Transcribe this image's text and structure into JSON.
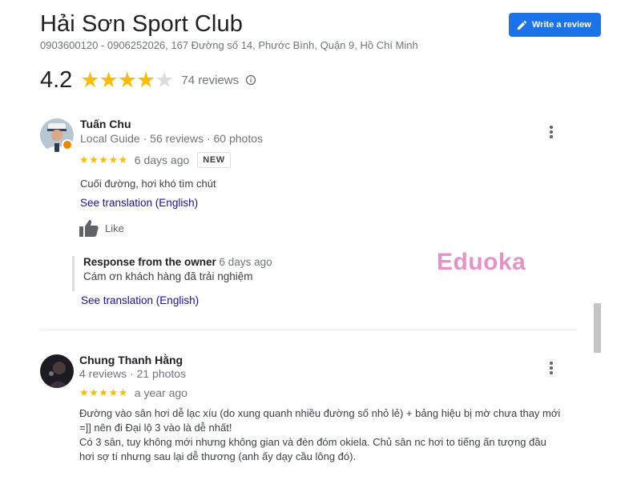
{
  "business": {
    "name": "Hải Sơn Sport Club",
    "contact": "0903600120 - 0906252026, 167 Đường số 14, Phước Bình, Quận 9, Hồ Chí Minh"
  },
  "write_review": {
    "label": "Write a review",
    "icon": "pencil-icon"
  },
  "summary": {
    "rating": "4.2",
    "stars_filled": 4,
    "stars_total": 5,
    "review_count": "74 reviews"
  },
  "reviews": [
    {
      "author": "Tuấn Chu",
      "meta": "Local Guide · 56 reviews · 60 photos",
      "stars": "★★★★★",
      "time": "6 days ago",
      "badge": "NEW",
      "text": "Cuối đường, hơi khó tìm chút",
      "translate": "See translation (English)",
      "like": "Like",
      "owner_response": {
        "label": "Response from the owner",
        "time": "6 days ago",
        "text": "Cám ơn khách hàng đã trải nghiệm",
        "translate": "See translation (English)"
      }
    },
    {
      "author": "Chung Thanh Hằng",
      "meta": "4 reviews · 21 photos",
      "stars": "★★★★★",
      "time": "a year ago",
      "text_lines": [
        "Đường vào sân hơi dễ lạc xíu (do xung quanh nhiều đường số nhỏ lẻ) + bảng hiệu bị mờ chưa thay mới",
        "=]] nên đi Đại lộ 3 vào là dễ nhất!",
        "Có 3 sân, tuy không mới nhưng không gian và đèn đóm okiela. Chủ sân nc hơi to tiếng ấn tượng đầu",
        "hơi sợ tí nhưng sau lại dễ thương (anh ấy dạy cầu lông đó)."
      ]
    }
  ],
  "watermark": "Eduoka",
  "colors": {
    "accent": "#1a73e8",
    "star": "#fbbc04",
    "link": "#1a0dab",
    "watermark": "#e592c6"
  }
}
